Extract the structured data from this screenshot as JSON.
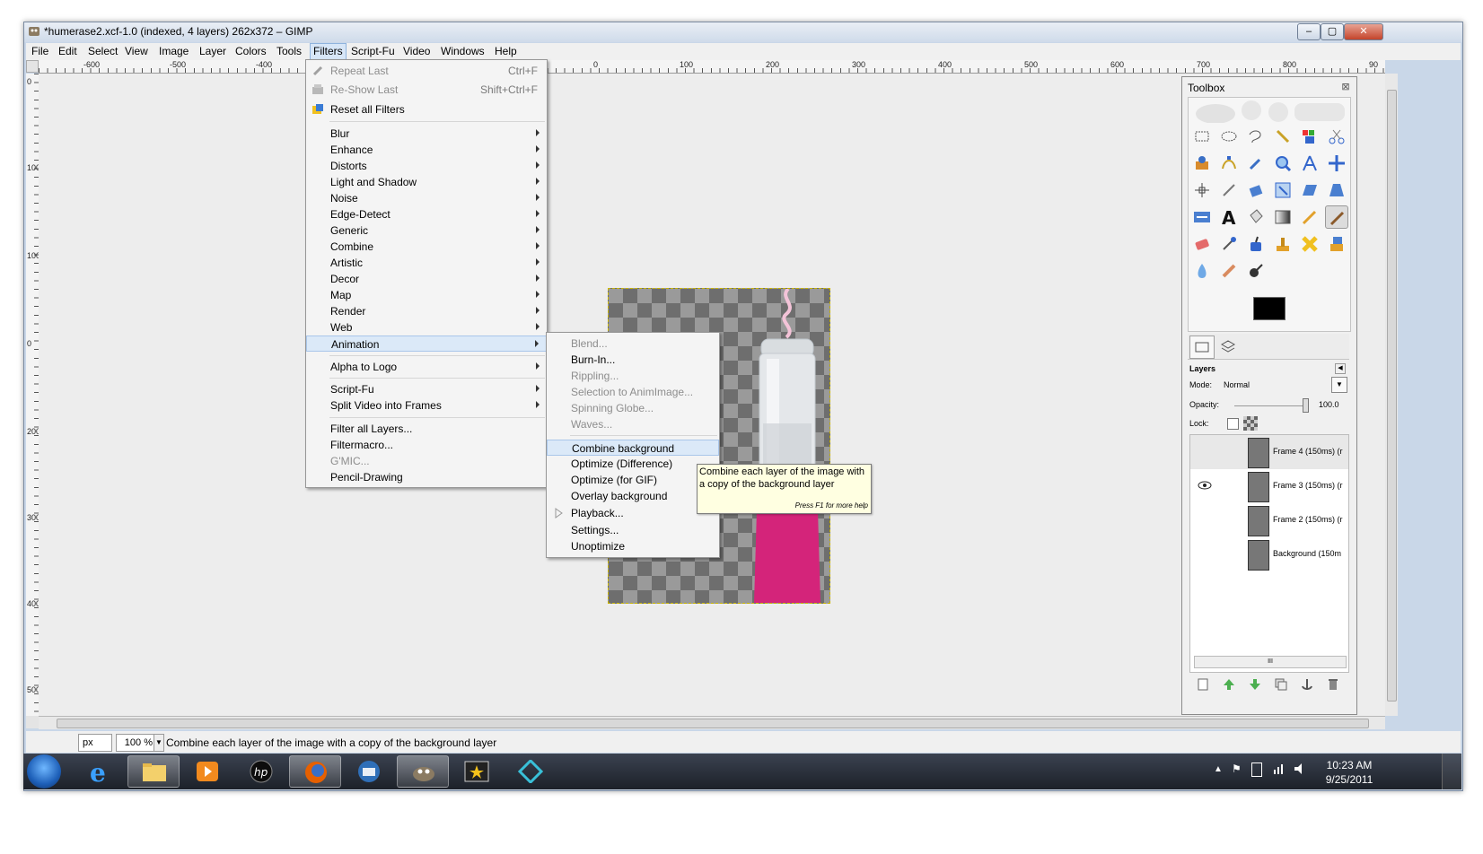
{
  "window": {
    "title": "*humerase2.xcf-1.0 (indexed, 4 layers) 262x372 – GIMP",
    "minimize_glyph": "–",
    "maximize_glyph": "▢",
    "close_glyph": "✕"
  },
  "menubar": {
    "items": [
      "File",
      "Edit",
      "Select",
      "View",
      "Image",
      "Layer",
      "Colors",
      "Tools",
      "Filters",
      "Script-Fu",
      "Video",
      "Windows",
      "Help"
    ],
    "active": "Filters"
  },
  "ruler": {
    "h_labels": [
      "-600",
      "-500",
      "-400",
      "0",
      "100",
      "200",
      "300",
      "400",
      "500",
      "600",
      "700",
      "800",
      "90"
    ],
    "v_labels": [
      "0",
      "100",
      "100",
      "0",
      "200",
      "300",
      "400",
      "500"
    ]
  },
  "filters_menu": {
    "items": [
      {
        "label": "Repeat Last",
        "accel": "Ctrl+F",
        "disabled": true,
        "icon": "repeat-icon"
      },
      {
        "label": "Re-Show Last",
        "accel": "Shift+Ctrl+F",
        "disabled": true,
        "icon": "reshow-icon"
      },
      {
        "label": "Reset all Filters",
        "accel": "",
        "disabled": false,
        "icon": "reset-icon"
      },
      {
        "label": "Blur",
        "submenu": true
      },
      {
        "label": "Enhance",
        "submenu": true
      },
      {
        "label": "Distorts",
        "submenu": true
      },
      {
        "label": "Light and Shadow",
        "submenu": true
      },
      {
        "label": "Noise",
        "submenu": true
      },
      {
        "label": "Edge-Detect",
        "submenu": true
      },
      {
        "label": "Generic",
        "submenu": true
      },
      {
        "label": "Combine",
        "submenu": true
      },
      {
        "label": "Artistic",
        "submenu": true
      },
      {
        "label": "Decor",
        "submenu": true
      },
      {
        "label": "Map",
        "submenu": true
      },
      {
        "label": "Render",
        "submenu": true
      },
      {
        "label": "Web",
        "submenu": true
      },
      {
        "label": "Animation",
        "submenu": true,
        "highlighted": true
      },
      {
        "label": "Alpha to Logo",
        "submenu": true
      },
      {
        "label": "Script-Fu",
        "submenu": true
      },
      {
        "label": "Split Video into Frames",
        "submenu": true
      },
      {
        "label": "Filter all Layers..."
      },
      {
        "label": "Filtermacro..."
      },
      {
        "label": "G'MIC...",
        "disabled": true
      },
      {
        "label": "Pencil-Drawing"
      }
    ]
  },
  "animation_menu": {
    "items": [
      {
        "label": "Blend...",
        "disabled": true
      },
      {
        "label": "Burn-In..."
      },
      {
        "label": "Rippling...",
        "disabled": true
      },
      {
        "label": "Selection to AnimImage...",
        "disabled": true
      },
      {
        "label": "Spinning Globe...",
        "disabled": true
      },
      {
        "label": "Waves...",
        "disabled": true
      },
      {
        "label": "Combine background",
        "highlighted": true
      },
      {
        "label": "Optimize (Difference)"
      },
      {
        "label": "Optimize (for GIF)"
      },
      {
        "label": "Overlay background"
      },
      {
        "label": "Playback..."
      },
      {
        "label": "Settings..."
      },
      {
        "label": "Unoptimize"
      }
    ]
  },
  "tooltip": {
    "line1": "Combine each layer of the image with",
    "line2": "a copy of the background layer",
    "hint": "Press F1 for more help"
  },
  "statusbar": {
    "unit": "px",
    "zoom": "100 %",
    "message": "Combine each layer of the image with a copy of the background layer"
  },
  "toolbox": {
    "title": "Toolbox",
    "close_glyph": "⊠"
  },
  "layers": {
    "title": "Layers",
    "mode_label": "Mode:",
    "mode_value": "Normal",
    "opacity_label": "Opacity:",
    "opacity_value": "100.0",
    "lock_label": "Lock:",
    "items": [
      {
        "name": "Frame 4 (150ms) (r",
        "visible": false,
        "selected": true
      },
      {
        "name": "Frame 3 (150ms) (r",
        "visible": true,
        "selected": false
      },
      {
        "name": "Frame 2 (150ms) (r",
        "visible": false,
        "selected": false
      },
      {
        "name": "Background (150m",
        "visible": false,
        "selected": false
      }
    ],
    "scroll_glyph": "III"
  },
  "taskbar": {
    "time": "10:23 AM",
    "date": "9/25/2011"
  },
  "colors": {
    "menu_highlight": "#dbe9f8",
    "bottle_pink": "#d4247a",
    "tooltip_bg": "#ffffe1"
  }
}
